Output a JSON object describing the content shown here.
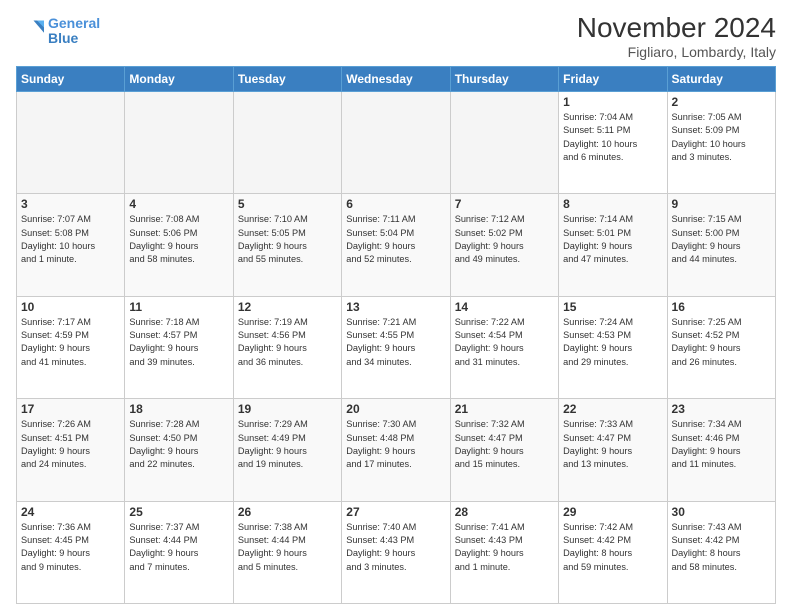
{
  "header": {
    "logo_line1": "General",
    "logo_line2": "Blue",
    "title": "November 2024",
    "location": "Figliaro, Lombardy, Italy"
  },
  "weekdays": [
    "Sunday",
    "Monday",
    "Tuesday",
    "Wednesday",
    "Thursday",
    "Friday",
    "Saturday"
  ],
  "weeks": [
    [
      {
        "day": "",
        "info": ""
      },
      {
        "day": "",
        "info": ""
      },
      {
        "day": "",
        "info": ""
      },
      {
        "day": "",
        "info": ""
      },
      {
        "day": "",
        "info": ""
      },
      {
        "day": "1",
        "info": "Sunrise: 7:04 AM\nSunset: 5:11 PM\nDaylight: 10 hours\nand 6 minutes."
      },
      {
        "day": "2",
        "info": "Sunrise: 7:05 AM\nSunset: 5:09 PM\nDaylight: 10 hours\nand 3 minutes."
      }
    ],
    [
      {
        "day": "3",
        "info": "Sunrise: 7:07 AM\nSunset: 5:08 PM\nDaylight: 10 hours\nand 1 minute."
      },
      {
        "day": "4",
        "info": "Sunrise: 7:08 AM\nSunset: 5:06 PM\nDaylight: 9 hours\nand 58 minutes."
      },
      {
        "day": "5",
        "info": "Sunrise: 7:10 AM\nSunset: 5:05 PM\nDaylight: 9 hours\nand 55 minutes."
      },
      {
        "day": "6",
        "info": "Sunrise: 7:11 AM\nSunset: 5:04 PM\nDaylight: 9 hours\nand 52 minutes."
      },
      {
        "day": "7",
        "info": "Sunrise: 7:12 AM\nSunset: 5:02 PM\nDaylight: 9 hours\nand 49 minutes."
      },
      {
        "day": "8",
        "info": "Sunrise: 7:14 AM\nSunset: 5:01 PM\nDaylight: 9 hours\nand 47 minutes."
      },
      {
        "day": "9",
        "info": "Sunrise: 7:15 AM\nSunset: 5:00 PM\nDaylight: 9 hours\nand 44 minutes."
      }
    ],
    [
      {
        "day": "10",
        "info": "Sunrise: 7:17 AM\nSunset: 4:59 PM\nDaylight: 9 hours\nand 41 minutes."
      },
      {
        "day": "11",
        "info": "Sunrise: 7:18 AM\nSunset: 4:57 PM\nDaylight: 9 hours\nand 39 minutes."
      },
      {
        "day": "12",
        "info": "Sunrise: 7:19 AM\nSunset: 4:56 PM\nDaylight: 9 hours\nand 36 minutes."
      },
      {
        "day": "13",
        "info": "Sunrise: 7:21 AM\nSunset: 4:55 PM\nDaylight: 9 hours\nand 34 minutes."
      },
      {
        "day": "14",
        "info": "Sunrise: 7:22 AM\nSunset: 4:54 PM\nDaylight: 9 hours\nand 31 minutes."
      },
      {
        "day": "15",
        "info": "Sunrise: 7:24 AM\nSunset: 4:53 PM\nDaylight: 9 hours\nand 29 minutes."
      },
      {
        "day": "16",
        "info": "Sunrise: 7:25 AM\nSunset: 4:52 PM\nDaylight: 9 hours\nand 26 minutes."
      }
    ],
    [
      {
        "day": "17",
        "info": "Sunrise: 7:26 AM\nSunset: 4:51 PM\nDaylight: 9 hours\nand 24 minutes."
      },
      {
        "day": "18",
        "info": "Sunrise: 7:28 AM\nSunset: 4:50 PM\nDaylight: 9 hours\nand 22 minutes."
      },
      {
        "day": "19",
        "info": "Sunrise: 7:29 AM\nSunset: 4:49 PM\nDaylight: 9 hours\nand 19 minutes."
      },
      {
        "day": "20",
        "info": "Sunrise: 7:30 AM\nSunset: 4:48 PM\nDaylight: 9 hours\nand 17 minutes."
      },
      {
        "day": "21",
        "info": "Sunrise: 7:32 AM\nSunset: 4:47 PM\nDaylight: 9 hours\nand 15 minutes."
      },
      {
        "day": "22",
        "info": "Sunrise: 7:33 AM\nSunset: 4:47 PM\nDaylight: 9 hours\nand 13 minutes."
      },
      {
        "day": "23",
        "info": "Sunrise: 7:34 AM\nSunset: 4:46 PM\nDaylight: 9 hours\nand 11 minutes."
      }
    ],
    [
      {
        "day": "24",
        "info": "Sunrise: 7:36 AM\nSunset: 4:45 PM\nDaylight: 9 hours\nand 9 minutes."
      },
      {
        "day": "25",
        "info": "Sunrise: 7:37 AM\nSunset: 4:44 PM\nDaylight: 9 hours\nand 7 minutes."
      },
      {
        "day": "26",
        "info": "Sunrise: 7:38 AM\nSunset: 4:44 PM\nDaylight: 9 hours\nand 5 minutes."
      },
      {
        "day": "27",
        "info": "Sunrise: 7:40 AM\nSunset: 4:43 PM\nDaylight: 9 hours\nand 3 minutes."
      },
      {
        "day": "28",
        "info": "Sunrise: 7:41 AM\nSunset: 4:43 PM\nDaylight: 9 hours\nand 1 minute."
      },
      {
        "day": "29",
        "info": "Sunrise: 7:42 AM\nSunset: 4:42 PM\nDaylight: 8 hours\nand 59 minutes."
      },
      {
        "day": "30",
        "info": "Sunrise: 7:43 AM\nSunset: 4:42 PM\nDaylight: 8 hours\nand 58 minutes."
      }
    ]
  ]
}
